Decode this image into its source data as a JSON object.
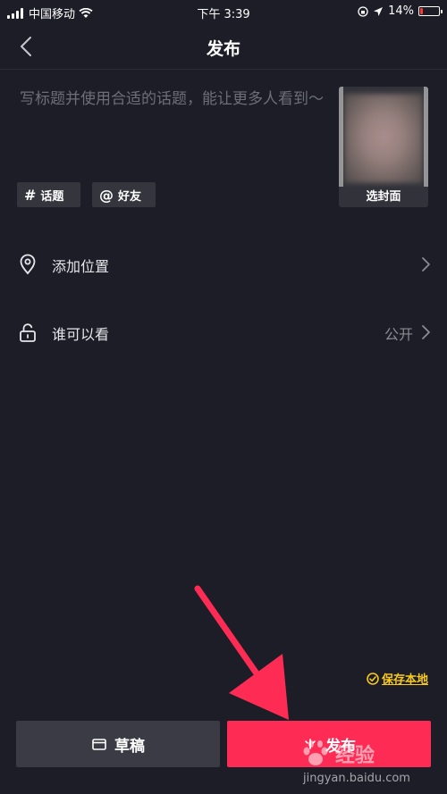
{
  "status_bar": {
    "carrier": "中国移动",
    "time": "下午 3:39",
    "battery": "14%",
    "battery_level": 0.14
  },
  "nav": {
    "title": "发布"
  },
  "compose": {
    "placeholder": "写标题并使用合适的话题，能让更多人看到～",
    "cover_label": "选封面"
  },
  "tags": {
    "topic_label": "话题",
    "friend_label": "好友"
  },
  "options": [
    {
      "label": "添加位置",
      "value": ""
    },
    {
      "label": "谁可以看",
      "value": "公开"
    }
  ],
  "footer": {
    "save_local_label": "保存本地",
    "draft_label": "草稿",
    "publish_label": "发布"
  },
  "watermark": {
    "brand": "经验",
    "url": "jingyan.baidu.com"
  },
  "colors": {
    "background": "#1c1d26",
    "publish": "#fe2c55",
    "accent_yellow": "#f8c91c",
    "annotation_arrow": "#fe2c55"
  }
}
